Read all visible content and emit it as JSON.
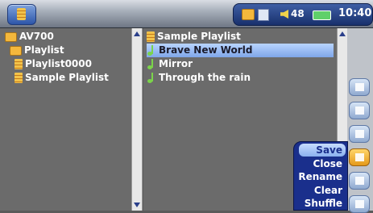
{
  "status": {
    "volume": "48",
    "time": "10:40"
  },
  "left_pane": {
    "items": [
      {
        "label": "AV700",
        "icon": "folder-icon"
      },
      {
        "label": "Playlist",
        "icon": "folder-icon"
      },
      {
        "label": "Playlist0000",
        "icon": "playlist-icon"
      },
      {
        "label": "Sample Playlist",
        "icon": "playlist-icon"
      }
    ]
  },
  "right_pane": {
    "header": "Sample Playlist",
    "items": [
      {
        "label": "Brave New World",
        "icon": "music-note-icon",
        "selected": true
      },
      {
        "label": "Mirror",
        "icon": "music-note-icon"
      },
      {
        "label": "Through the rain",
        "icon": "music-note-icon"
      }
    ]
  },
  "context_menu": {
    "items": [
      {
        "label": "Save",
        "selected": true
      },
      {
        "label": "Close"
      },
      {
        "label": "Rename"
      },
      {
        "label": "Clear"
      },
      {
        "label": "Shuffle"
      }
    ]
  },
  "colors": {
    "accent": "#1a2f8c",
    "selection": "#8bb0ee",
    "pane_bg": "#6b6b6b",
    "note_green": "#7bd44a"
  }
}
